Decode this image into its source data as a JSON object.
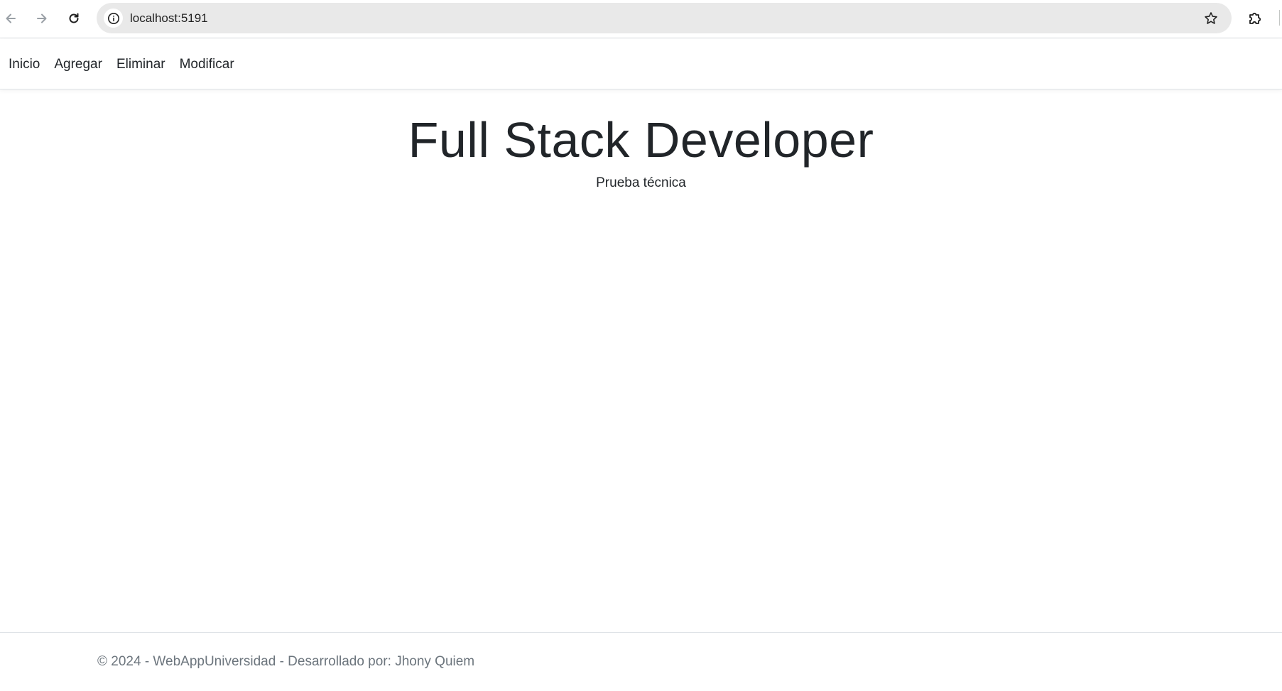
{
  "browser": {
    "url": "localhost:5191",
    "icons": {
      "back": "arrow-left-icon",
      "forward": "arrow-right-icon",
      "reload": "reload-icon",
      "site_info": "info-icon",
      "bookmark": "star-icon",
      "extensions": "puzzle-icon"
    }
  },
  "navbar": {
    "links": [
      {
        "label": "Inicio"
      },
      {
        "label": "Agregar"
      },
      {
        "label": "Eliminar"
      },
      {
        "label": "Modificar"
      }
    ]
  },
  "main": {
    "title": "Full Stack Developer",
    "subtitle": "Prueba técnica"
  },
  "footer": {
    "text": "© 2024 - WebAppUniversidad - Desarrollado por: Jhony Quiem"
  },
  "colors": {
    "text": "#212529",
    "muted": "#6c757d",
    "omnibox_bg": "#e9e9e9",
    "border": "#dee2e6"
  }
}
